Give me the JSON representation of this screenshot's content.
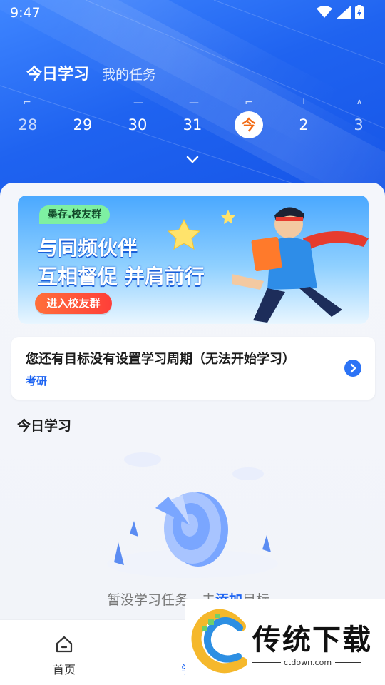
{
  "status_bar": {
    "time": "9:47"
  },
  "header": {
    "tabs": [
      {
        "label": "今日学习",
        "active": true
      },
      {
        "label": "我的任务",
        "active": false
      }
    ]
  },
  "calendar": {
    "dates": [
      {
        "label": "28",
        "dim": true
      },
      {
        "label": "29",
        "dim": false
      },
      {
        "label": "30",
        "dim": false
      },
      {
        "label": "31",
        "dim": false
      },
      {
        "label": "今",
        "today": true
      },
      {
        "label": "2",
        "dim": false
      },
      {
        "label": "3",
        "dim": true
      }
    ],
    "expand_icon": "chevron-down-icon"
  },
  "banner": {
    "chip": "墨存.校友群",
    "line1": "与同频伙伴",
    "line2": "互相督促 并肩前行",
    "cta": "进入校友群"
  },
  "notice": {
    "title": "您还有目标没有设置学习周期（无法开始学习）",
    "tag": "考研",
    "arrow_icon": "chevron-right-icon"
  },
  "today_section": {
    "title": "今日学习",
    "empty_text_prefix": "暂没学习任务，去",
    "empty_text_link": "添加",
    "empty_text_suffix": "目标"
  },
  "bottom_nav": {
    "items": [
      {
        "label": "首页",
        "icon": "home-icon"
      },
      {
        "label": "学习",
        "icon": "study-icon"
      }
    ]
  },
  "watermark": {
    "brand": "传统下载",
    "site": "ctdown.com"
  },
  "colors": {
    "primary": "#1d64f2",
    "today_accent": "#f26a12",
    "hero": "#1f63f0"
  }
}
